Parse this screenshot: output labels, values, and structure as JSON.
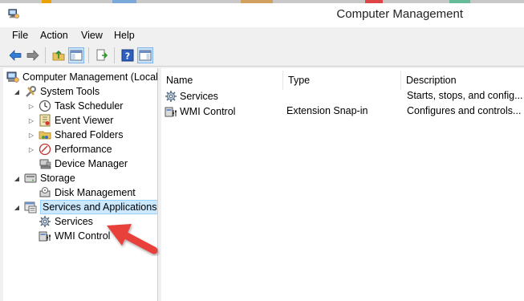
{
  "window": {
    "title": "Computer Management"
  },
  "menu": [
    {
      "label": "File"
    },
    {
      "label": "Action"
    },
    {
      "label": "View"
    },
    {
      "label": "Help"
    }
  ],
  "toolbar": [
    {
      "icon": "back-arrow-icon"
    },
    {
      "icon": "forward-arrow-icon"
    },
    {
      "icon": "up-folder-icon"
    },
    {
      "icon": "show-hide-console-tree-icon"
    },
    {
      "icon": "export-list-icon"
    },
    {
      "icon": "help-icon"
    },
    {
      "icon": "show-hide-action-pane-icon"
    }
  ],
  "tree": [
    {
      "label": "Computer Management (Local",
      "icon": "computer-management-icon",
      "expander": "none",
      "level": 0
    },
    {
      "label": "System Tools",
      "icon": "system-tools-icon",
      "expander": "expanded",
      "level": 1
    },
    {
      "label": "Task Scheduler",
      "icon": "clock-icon",
      "expander": "collapsed",
      "level": 2
    },
    {
      "label": "Event Viewer",
      "icon": "event-viewer-icon",
      "expander": "collapsed",
      "level": 2
    },
    {
      "label": "Shared Folders",
      "icon": "shared-folders-icon",
      "expander": "collapsed",
      "level": 2
    },
    {
      "label": "Performance",
      "icon": "performance-icon",
      "expander": "collapsed",
      "level": 2
    },
    {
      "label": "Device Manager",
      "icon": "device-manager-icon",
      "expander": "none",
      "level": 2
    },
    {
      "label": "Storage",
      "icon": "storage-icon",
      "expander": "expanded",
      "level": 1
    },
    {
      "label": "Disk Management",
      "icon": "disk-management-icon",
      "expander": "none",
      "level": 2
    },
    {
      "label": "Services and Applications",
      "icon": "services-applications-icon",
      "expander": "expanded",
      "level": 1,
      "selected": true
    },
    {
      "label": "Services",
      "icon": "services-gear-icon",
      "expander": "none",
      "level": 2
    },
    {
      "label": "WMI Control",
      "icon": "wmi-control-icon",
      "expander": "none",
      "level": 2
    }
  ],
  "list": {
    "columns": [
      {
        "label": "Name"
      },
      {
        "label": "Type"
      },
      {
        "label": "Description"
      }
    ],
    "rows": [
      {
        "name": "Services",
        "type": "",
        "description": "Starts, stops, and config...",
        "icon": "services-gear-icon"
      },
      {
        "name": "WMI Control",
        "type": "Extension Snap-in",
        "description": "Configures and controls...",
        "icon": "wmi-control-icon"
      }
    ]
  },
  "annotation": {
    "type": "arrow",
    "color": "#e8403b",
    "points_to": "Services"
  },
  "colors": {
    "selection_bg": "#cce8ff",
    "selection_border": "#99d1ff",
    "toolbar_active_bg": "#cce4f7"
  }
}
